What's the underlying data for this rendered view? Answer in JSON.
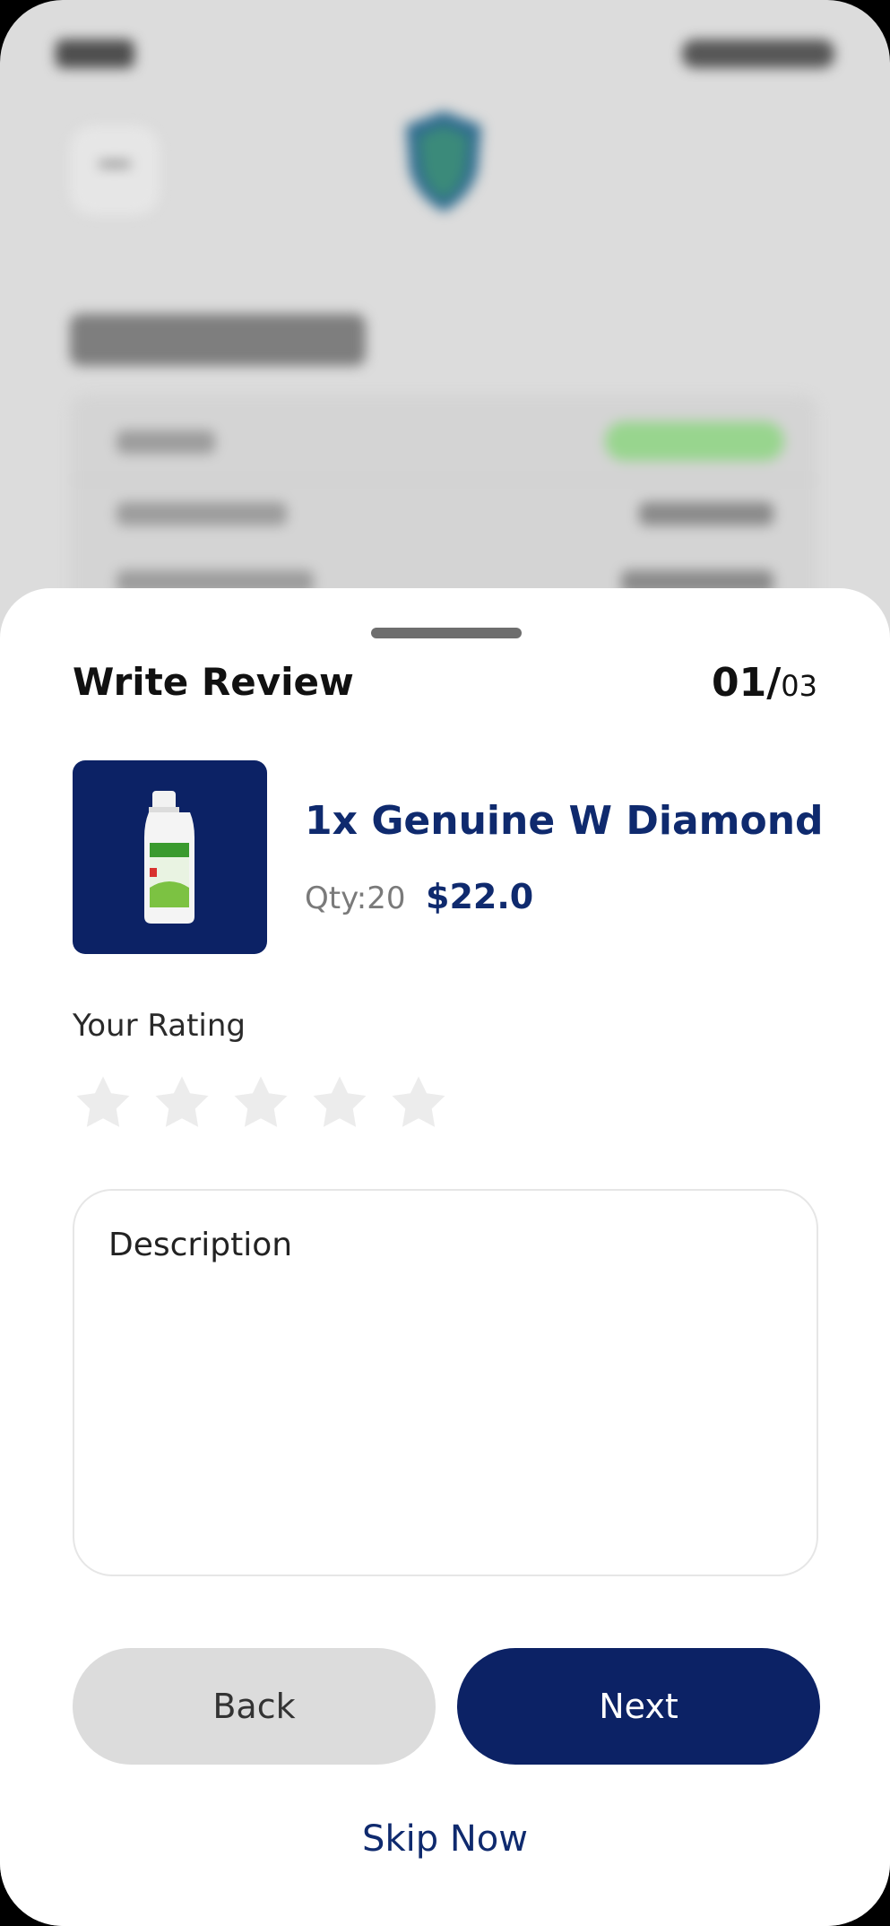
{
  "sheet": {
    "title": "Write Review",
    "counter_current": "01/",
    "counter_total": "03"
  },
  "product": {
    "name": "1x Genuine W Diamond",
    "qty": "Qty:20",
    "price": "$22.0",
    "thumbnail_icon": "mouthwash-bottle-image",
    "thumbnail_bg": "#0c2265"
  },
  "rating": {
    "label": "Your Rating",
    "max": 5,
    "value": 0,
    "star_color": "#ececec"
  },
  "description": {
    "placeholder": "Description",
    "value": ""
  },
  "buttons": {
    "back_label": "Back",
    "next_label": "Next",
    "skip_label": "Skip Now"
  },
  "colors": {
    "accent": "#0c2265",
    "secondary_button": "#dcdcdc"
  }
}
